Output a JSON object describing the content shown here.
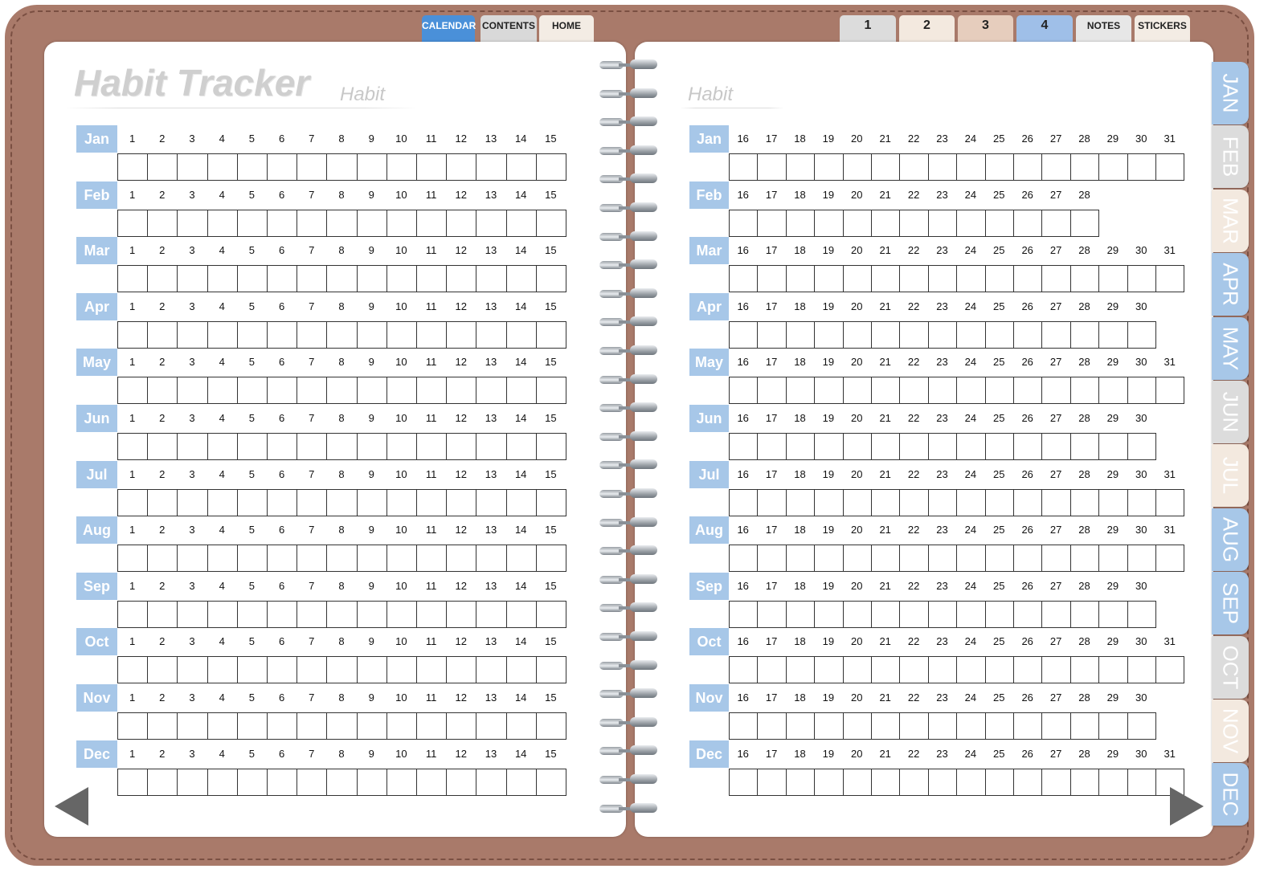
{
  "top_tabs": [
    {
      "label": "CALENDAR",
      "color": "#4a90d9",
      "text_color": "#ffffff"
    },
    {
      "label": "CONTENTS",
      "color": "#d9d9d9",
      "text_color": "#222222"
    },
    {
      "label": "HOME",
      "color": "#f3ece4",
      "text_color": "#222222"
    }
  ],
  "section_tabs": [
    {
      "label": "1",
      "color": "#dcdcdc"
    },
    {
      "label": "2",
      "color": "#f3e9df"
    },
    {
      "label": "3",
      "color": "#e6cdbd"
    },
    {
      "label": "4",
      "color": "#9fbfe8"
    },
    {
      "label": "NOTES",
      "color": "#e7e7e7"
    },
    {
      "label": "STICKERS",
      "color": "#f3ece4"
    }
  ],
  "left_page": {
    "title": "Habit Tracker",
    "subtitle": "Habit"
  },
  "right_page": {
    "subtitle": "Habit"
  },
  "months": [
    {
      "label": "Jan",
      "days": 31
    },
    {
      "label": "Feb",
      "days": 28
    },
    {
      "label": "Mar",
      "days": 31
    },
    {
      "label": "Apr",
      "days": 30
    },
    {
      "label": "May",
      "days": 31
    },
    {
      "label": "Jun",
      "days": 30
    },
    {
      "label": "Jul",
      "days": 31
    },
    {
      "label": "Aug",
      "days": 31
    },
    {
      "label": "Sep",
      "days": 30
    },
    {
      "label": "Oct",
      "days": 31
    },
    {
      "label": "Nov",
      "days": 30
    },
    {
      "label": "Dec",
      "days": 31
    }
  ],
  "side_tabs": [
    {
      "label": "JAN",
      "color": "#a7c7e8"
    },
    {
      "label": "FEB",
      "color": "#dcdcdc"
    },
    {
      "label": "MAR",
      "color": "#f3e9df"
    },
    {
      "label": "APR",
      "color": "#a7c7e8"
    },
    {
      "label": "MAY",
      "color": "#a7c7e8"
    },
    {
      "label": "JUN",
      "color": "#dcdcdc"
    },
    {
      "label": "JUL",
      "color": "#f3e9df"
    },
    {
      "label": "AUG",
      "color": "#a7c7e8"
    },
    {
      "label": "SEP",
      "color": "#a7c7e8"
    },
    {
      "label": "OCT",
      "color": "#dcdcdc"
    },
    {
      "label": "NOV",
      "color": "#f3e9df"
    },
    {
      "label": "DEC",
      "color": "#a7c7e8"
    }
  ],
  "colors": {
    "cover": "#a97a6a",
    "month_label": "#a7c7e8",
    "arrow": "#666666"
  }
}
